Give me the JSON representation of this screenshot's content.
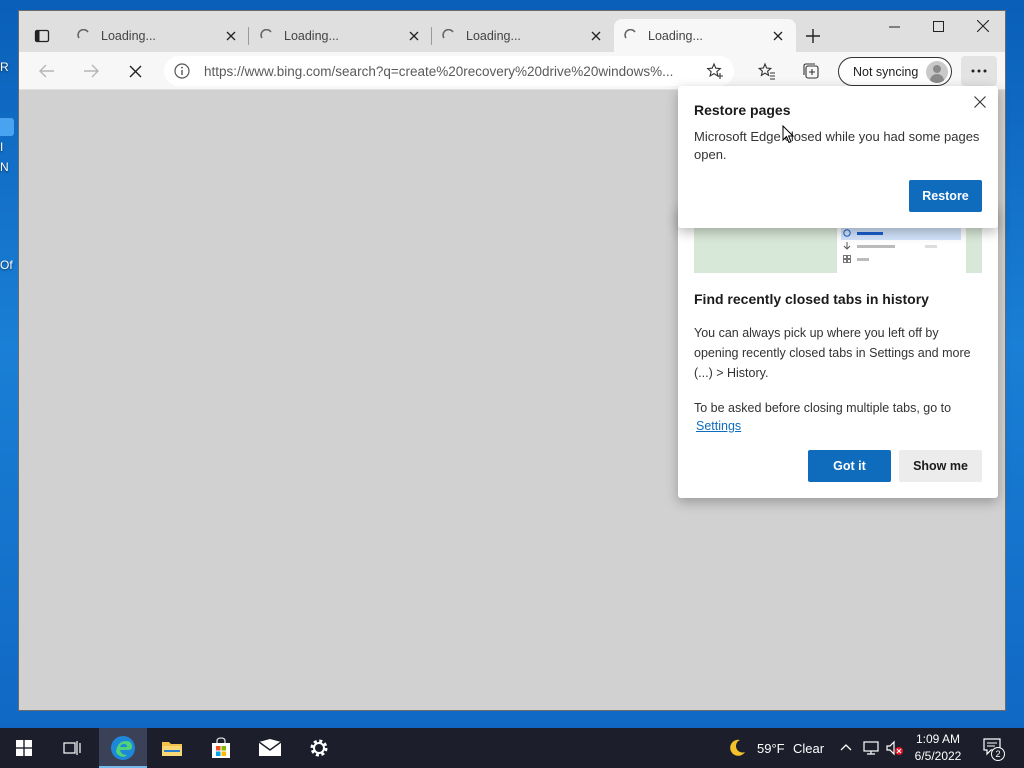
{
  "desktop": {
    "fragments": [
      "R",
      "I",
      "N",
      "Of"
    ]
  },
  "browser": {
    "tabs": [
      {
        "title": "Loading...",
        "active": false
      },
      {
        "title": "Loading...",
        "active": false
      },
      {
        "title": "Loading...",
        "active": false
      },
      {
        "title": "Loading...",
        "active": true
      }
    ],
    "address_url": "https://www.bing.com/search?q=create%20recovery%20drive%20windows%...",
    "sync_label": "Not syncing"
  },
  "restore_popup": {
    "title": "Restore pages",
    "message": "Microsoft Edge closed while you had some pages open.",
    "restore_button": "Restore"
  },
  "history_tip": {
    "title": "Find recently closed tabs in history",
    "body": "You can always pick up where you left off by opening recently closed tabs in Settings and more (...) > History.",
    "settings_prompt": "To be asked before closing multiple tabs, go to",
    "settings_link": "Settings",
    "got_it_button": "Got it",
    "show_me_button": "Show me"
  },
  "taskbar": {
    "weather_temp": "59°F",
    "weather_desc": "Clear",
    "time": "1:09 AM",
    "date": "6/5/2022",
    "notification_count": "2"
  },
  "colors": {
    "accent": "#0f6cbd",
    "taskbar": "#1c1f2b",
    "content_bg": "#d1d1d1"
  }
}
